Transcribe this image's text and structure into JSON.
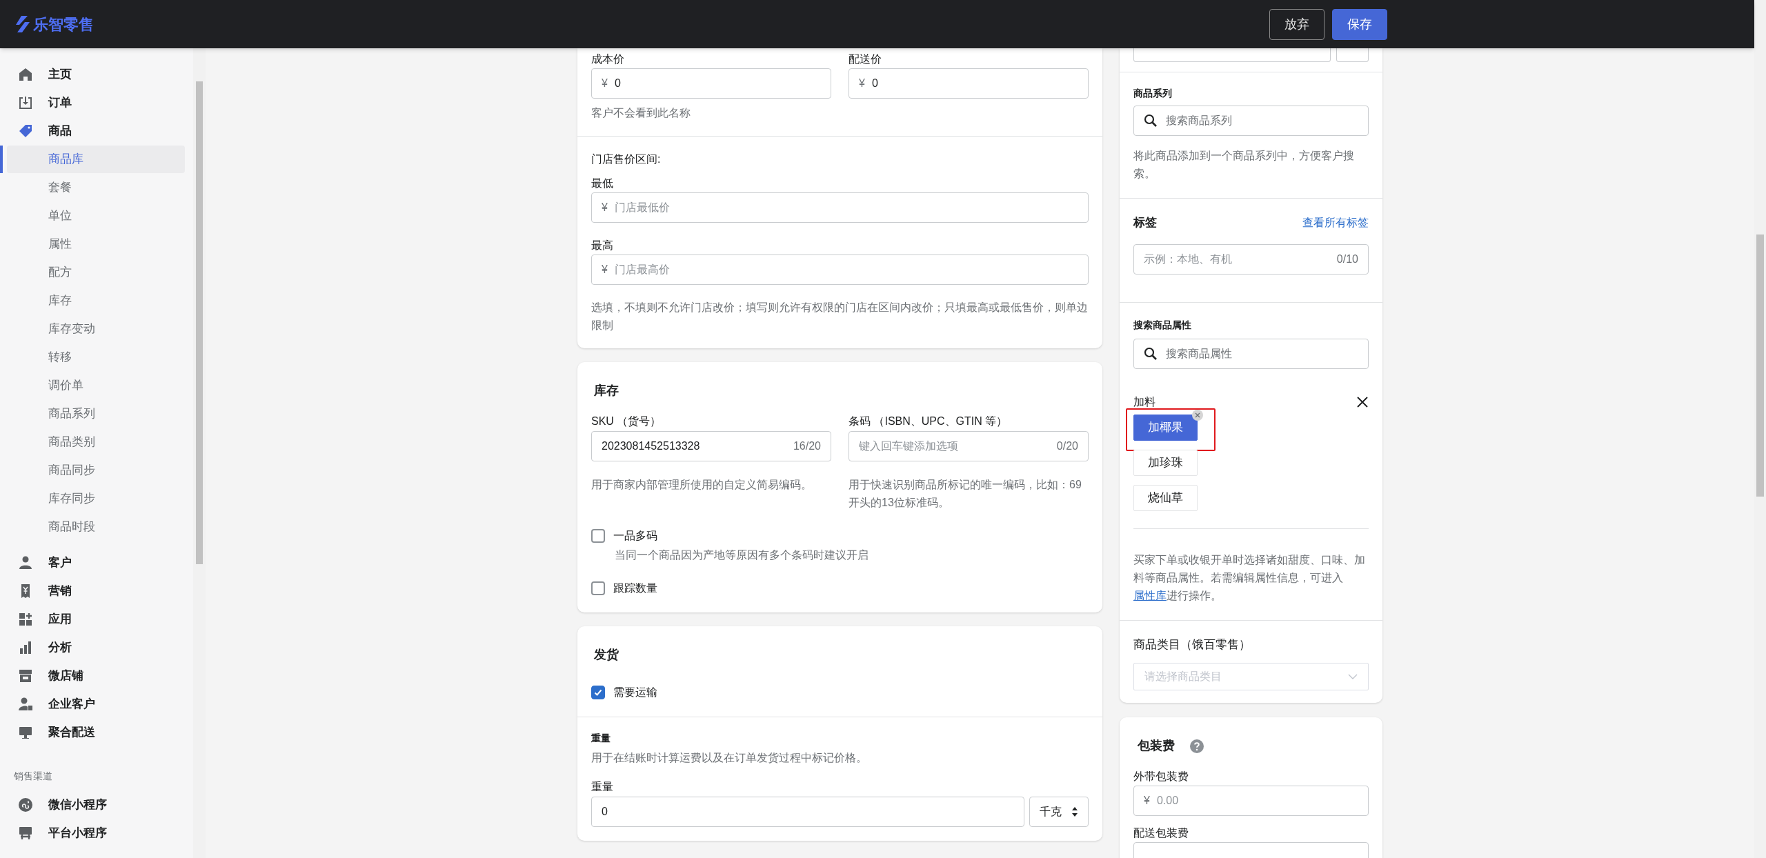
{
  "app": {
    "logo": "乐智零售"
  },
  "header_buttons": [
    {
      "label": "放弃",
      "kind": "secondary"
    },
    {
      "label": "保存",
      "kind": "primary"
    }
  ],
  "sidebar": {
    "items": [
      {
        "label": "主页",
        "selected": false
      },
      {
        "label": "订单",
        "selected": false
      },
      {
        "label": "商品",
        "selected": true,
        "children": [
          {
            "label": "商品库",
            "selected": true
          },
          {
            "label": "套餐",
            "selected": false
          },
          {
            "label": "单位",
            "selected": false
          },
          {
            "label": "属性",
            "selected": false
          },
          {
            "label": "配方",
            "selected": false
          },
          {
            "label": "库存",
            "selected": false
          },
          {
            "label": "库存变动",
            "selected": false
          },
          {
            "label": "转移",
            "selected": false
          },
          {
            "label": "调价单",
            "selected": false
          },
          {
            "label": "商品系列",
            "selected": false
          },
          {
            "label": "商品类别",
            "selected": false
          },
          {
            "label": "商品同步",
            "selected": false
          },
          {
            "label": "库存同步",
            "selected": false
          },
          {
            "label": "商品时段",
            "selected": false
          }
        ]
      },
      {
        "label": "客户",
        "selected": false
      },
      {
        "label": "营销",
        "selected": false
      },
      {
        "label": "应用",
        "selected": false
      },
      {
        "label": "分析",
        "selected": false
      },
      {
        "label": "微店铺",
        "selected": false
      },
      {
        "label": "企业客户",
        "selected": false
      },
      {
        "label": "聚合配送",
        "selected": false
      }
    ],
    "section_title": "销售渠道",
    "channels": [
      {
        "label": "微信小程序",
        "selected": false
      },
      {
        "label": "平台小程序",
        "selected": false
      }
    ]
  },
  "pricing": {
    "fields": [
      {
        "label": "成本价",
        "prefix": "¥",
        "value": "0"
      },
      {
        "label": "配送价",
        "prefix": "¥",
        "value": "0"
      }
    ],
    "fields_help": "客户不会看到此名称",
    "range_title": "门店售价区间:",
    "range_fields": [
      {
        "label": "最低",
        "prefix": "¥",
        "placeholder": "门店最低价"
      },
      {
        "label": "最高",
        "prefix": "¥",
        "placeholder": "门店最高价"
      }
    ],
    "range_help": "选填，不填则不允许门店改价；填写则允许有权限的门店在区间内改价；只填最高或最低售价，则单边限制"
  },
  "inventory": {
    "title": "库存",
    "fields": [
      {
        "label": "SKU （货号）",
        "value": "2023081452513328",
        "counter": "16/20",
        "help": "用于商家内部管理所使用的自定义简易编码。"
      },
      {
        "label": "条码 （ISBN、UPC、GTIN 等）",
        "placeholder": "键入回车键添加选项",
        "counter": "0/20",
        "help": "用于快速识别商品所标记的唯一编码，比如：69开头的13位标准码。"
      }
    ],
    "options": [
      {
        "label": "一品多码",
        "checked": false,
        "help": "当同一个商品因为产地等原因有多个条码时建议开启"
      },
      {
        "label": "跟踪数量",
        "checked": false
      }
    ]
  },
  "shipping": {
    "title": "发货",
    "options": [
      {
        "label": "需要运输",
        "checked": true
      }
    ],
    "weight": {
      "heading": "重量",
      "help": "用于在结账时计算运费以及在订单发货过程中标记价格。",
      "label": "重量",
      "value": "0",
      "unit": "千克"
    }
  },
  "organization": {
    "series": {
      "label": "商品系列",
      "placeholder": "搜索商品系列",
      "help": "将此商品添加到一个商品系列中，方便客户搜索。"
    },
    "tags": {
      "title": "标签",
      "link": "查看所有标签",
      "placeholder": "示例：本地、有机",
      "counter": "0/10"
    },
    "attributes": {
      "label": "搜索商品属性",
      "placeholder": "搜索商品属性",
      "groups": [
        {
          "name": "加料",
          "values": [
            {
              "label": "加椰果",
              "selected": true,
              "highlighted": true
            },
            {
              "label": "加珍珠",
              "selected": false,
              "highlighted": false
            },
            {
              "label": "烧仙草",
              "selected": false,
              "highlighted": false
            }
          ]
        }
      ],
      "help_before": "买家下单或收银开单时选择诸如甜度、口味、加料等商品属性。若需编辑属性信息，可进入",
      "help_link": "属性库",
      "help_after": "进行操作。"
    },
    "category": {
      "label": "商品类目（饿百零售）",
      "placeholder": "请选择商品类目"
    }
  },
  "packaging": {
    "title": "包装费",
    "fields": [
      {
        "label": "外带包装费",
        "prefix": "¥",
        "placeholder": "0.00"
      },
      {
        "label": "配送包装费"
      }
    ]
  }
}
